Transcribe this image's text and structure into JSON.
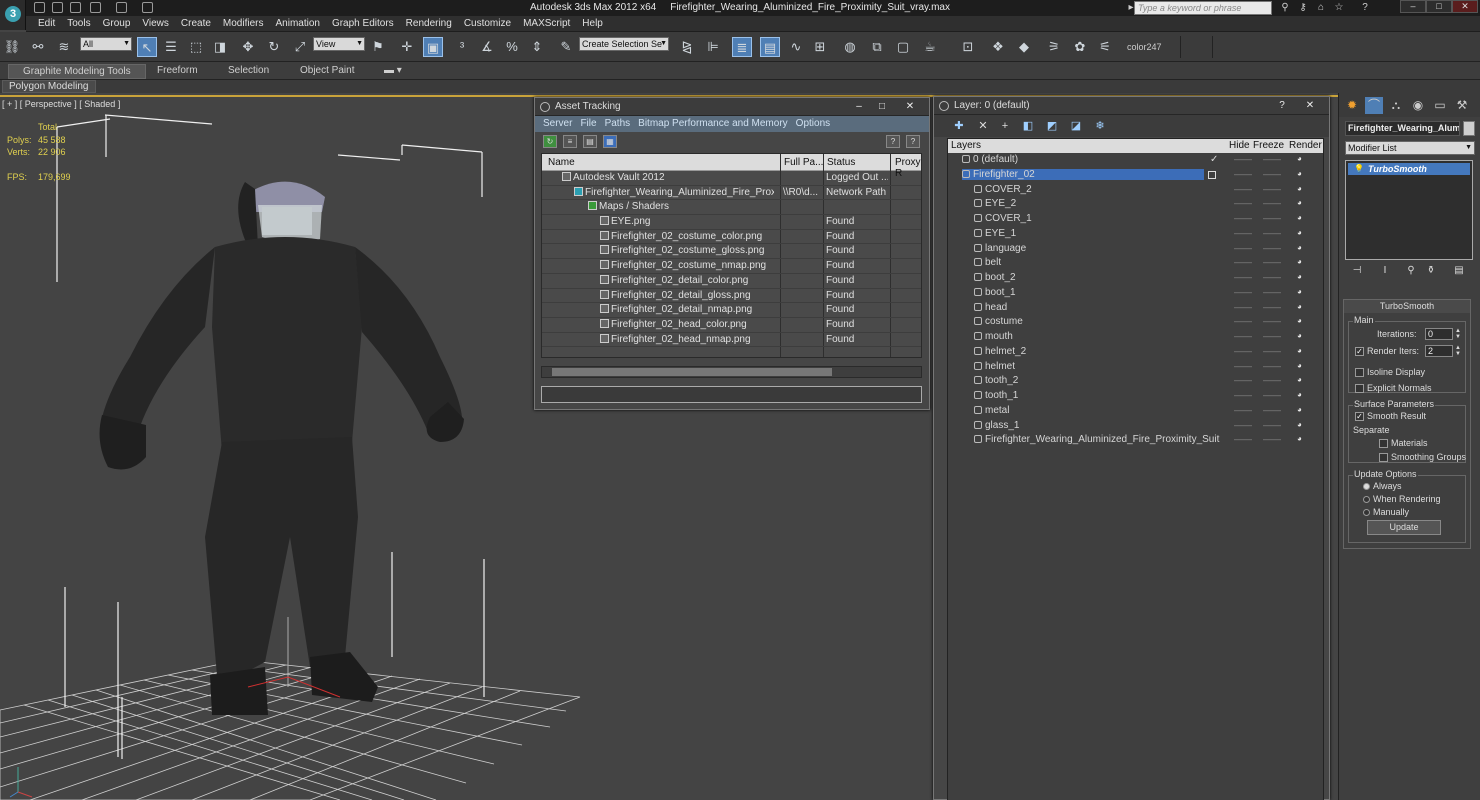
{
  "window": {
    "app_title": "Autodesk 3ds Max  2012 x64",
    "file_title": "Firefighter_Wearing_Aluminized_Fire_Proximity_Suit_vray.max",
    "search_placeholder": "Type a keyword or phrase",
    "min": "–",
    "max": "□",
    "close": "✕"
  },
  "menu": [
    "Edit",
    "Tools",
    "Group",
    "Views",
    "Create",
    "Modifiers",
    "Animation",
    "Graph Editors",
    "Rendering",
    "Customize",
    "MAXScript",
    "Help"
  ],
  "toolbar": {
    "filter_select": "All",
    "ref_coord_select": "View",
    "named_selection": "Create Selection Se",
    "color_label": "color247"
  },
  "ribbon": {
    "tabs": [
      "Graphite Modeling Tools",
      "Freeform",
      "Selection",
      "Object Paint"
    ],
    "sub_tab": "Polygon Modeling"
  },
  "viewport": {
    "label": "[ + ] [ Perspective ] [ Shaded ]",
    "stats": {
      "total_label": "Total",
      "polys_label": "Polys:",
      "polys_value": "45 588",
      "verts_label": "Verts:",
      "verts_value": "22 906",
      "fps_label": "FPS:",
      "fps_value": "179,699"
    }
  },
  "asset_tracking": {
    "title": "Asset Tracking",
    "menu": [
      "Server",
      "File",
      "Paths",
      "Bitmap Performance and Memory",
      "Options"
    ],
    "columns": [
      "Name",
      "Full Pa...",
      "Status",
      "Proxy R"
    ],
    "rows": [
      {
        "name": "Autodesk Vault 2012",
        "path": "",
        "status": "Logged Out ..."
      },
      {
        "name": "Firefighter_Wearing_Aluminized_Fire_Proximi...",
        "path": "\\\\R0\\d...",
        "status": "Network Path"
      },
      {
        "name": "Maps / Shaders",
        "path": "",
        "status": ""
      },
      {
        "name": "EYE.png",
        "path": "",
        "status": "Found"
      },
      {
        "name": "Firefighter_02_costume_color.png",
        "path": "",
        "status": "Found"
      },
      {
        "name": "Firefighter_02_costume_gloss.png",
        "path": "",
        "status": "Found"
      },
      {
        "name": "Firefighter_02_costume_nmap.png",
        "path": "",
        "status": "Found"
      },
      {
        "name": "Firefighter_02_detail_color.png",
        "path": "",
        "status": "Found"
      },
      {
        "name": "Firefighter_02_detail_gloss.png",
        "path": "",
        "status": "Found"
      },
      {
        "name": "Firefighter_02_detail_nmap.png",
        "path": "",
        "status": "Found"
      },
      {
        "name": "Firefighter_02_head_color.png",
        "path": "",
        "status": "Found"
      },
      {
        "name": "Firefighter_02_head_nmap.png",
        "path": "",
        "status": "Found"
      }
    ]
  },
  "layers": {
    "title": "Layer: 0 (default)",
    "help": "?",
    "columns": [
      "Layers",
      "Hide",
      "Freeze",
      "Render"
    ],
    "rows": [
      {
        "name": "0 (default)",
        "level": 0,
        "check": "✓"
      },
      {
        "name": "Firefighter_02",
        "level": 0,
        "selected": true
      },
      {
        "name": "COVER_2",
        "level": 1
      },
      {
        "name": "EYE_2",
        "level": 1
      },
      {
        "name": "COVER_1",
        "level": 1
      },
      {
        "name": "EYE_1",
        "level": 1
      },
      {
        "name": "language",
        "level": 1
      },
      {
        "name": "belt",
        "level": 1
      },
      {
        "name": "boot_2",
        "level": 1
      },
      {
        "name": "boot_1",
        "level": 1
      },
      {
        "name": "head",
        "level": 1
      },
      {
        "name": "costume",
        "level": 1
      },
      {
        "name": "mouth",
        "level": 1
      },
      {
        "name": "helmet_2",
        "level": 1
      },
      {
        "name": "helmet",
        "level": 1
      },
      {
        "name": "tooth_2",
        "level": 1
      },
      {
        "name": "tooth_1",
        "level": 1
      },
      {
        "name": "metal",
        "level": 1
      },
      {
        "name": "glass_1",
        "level": 1
      },
      {
        "name": "Firefighter_Wearing_Aluminized_Fire_Proximity_Suit",
        "level": 1
      }
    ],
    "dash": "——",
    "eye": "◕"
  },
  "command_panel": {
    "object_name": "Firefighter_Wearing_Aluminized_Fire_Proximity_Suit",
    "modifier_list": "Modifier List",
    "stack_item": "TurboSmooth",
    "turbosmooth": {
      "title": "TurboSmooth",
      "main": "Main",
      "iterations_label": "Iterations:",
      "iterations_value": "0",
      "render_iters_label": "Render Iters:",
      "render_iters_value": "2",
      "render_iters_checked": "✓",
      "isoline": "Isoline Display",
      "explicit": "Explicit Normals",
      "surface": "Surface Parameters",
      "smooth_result": "Smooth Result",
      "smooth_checked": "✓",
      "separate": "Separate",
      "materials": "Materials",
      "smoothing_groups": "Smoothing Groups",
      "update_options": "Update Options",
      "always": "Always",
      "when_rendering": "When Rendering",
      "manually": "Manually",
      "update_button": "Update"
    }
  },
  "colors": {
    "viewport_bg": "#444444",
    "selection_blue": "#3c6db8",
    "stats_yellow": "#e0d04f",
    "active_border": "#c9a33a"
  }
}
